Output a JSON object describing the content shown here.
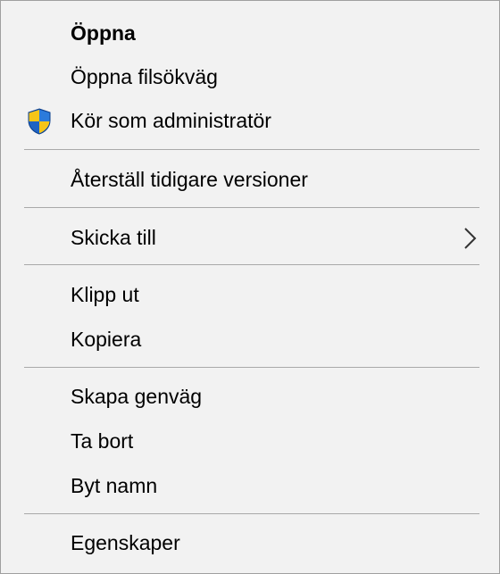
{
  "menu": {
    "items": [
      {
        "label": "Öppna"
      },
      {
        "label": "Öppna filsökväg"
      },
      {
        "label": "Kör som administratör",
        "icon": "uac-shield-icon"
      },
      {
        "label": "Återställ tidigare versioner"
      },
      {
        "label": "Skicka till",
        "icon": "chevron-right-icon"
      },
      {
        "label": "Klipp ut"
      },
      {
        "label": "Kopiera"
      },
      {
        "label": "Skapa genväg"
      },
      {
        "label": "Ta bort"
      },
      {
        "label": "Byt namn"
      },
      {
        "label": "Egenskaper"
      }
    ]
  },
  "colors": {
    "background": "#f2f2f2",
    "separator": "#a9a9a9",
    "border": "#a0a0a0",
    "shield_blue": "#1e63c4",
    "shield_yellow": "#f5c518"
  }
}
